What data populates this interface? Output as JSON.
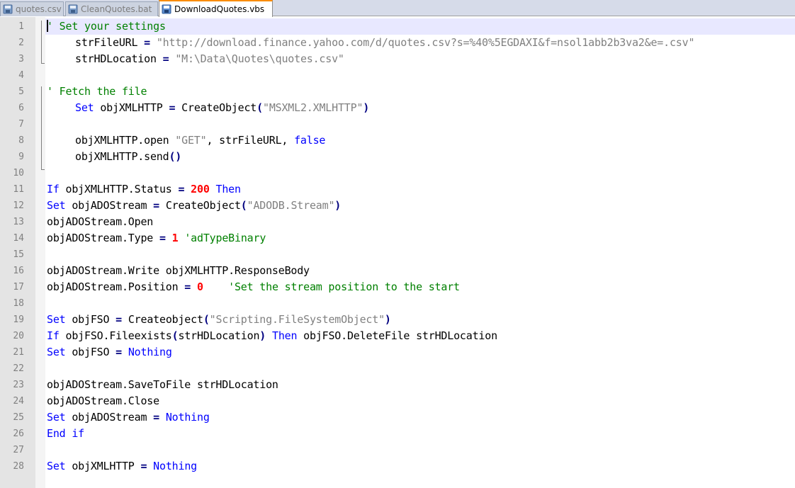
{
  "tabs": [
    {
      "label": "quotes.csv",
      "active": false,
      "icon": "file-saved-icon"
    },
    {
      "label": "CleanQuotes.bat",
      "active": false,
      "icon": "file-saved-icon"
    },
    {
      "label": "DownloadQuotes.vbs",
      "active": true,
      "icon": "file-saved-icon"
    }
  ],
  "colors": {
    "keyword": "#0000ff",
    "string": "#808080",
    "number": "#ff0000",
    "comment": "#008000",
    "current_line": "#e8e8ff",
    "active_tab_accent": "#fa8c00"
  },
  "lines": [
    {
      "n": "1",
      "tokens": [
        {
          "t": "' Set your settings",
          "c": "cmt"
        }
      ]
    },
    {
      "n": "2",
      "tokens": [
        {
          "t": "strFileURL ",
          "c": ""
        },
        {
          "t": "=",
          "c": "op"
        },
        {
          "t": " ",
          "c": ""
        },
        {
          "t": "\"http://download.finance.yahoo.com/d/quotes.csv?s=%40%5EGDAXI&f=nsol1abb2b3va2&e=.csv\"",
          "c": "str"
        }
      ]
    },
    {
      "n": "3",
      "tokens": [
        {
          "t": "strHDLocation ",
          "c": ""
        },
        {
          "t": "=",
          "c": "op"
        },
        {
          "t": " ",
          "c": ""
        },
        {
          "t": "\"M:\\Data\\Quotes\\quotes.csv\"",
          "c": "str"
        }
      ]
    },
    {
      "n": "4",
      "tokens": []
    },
    {
      "n": "5",
      "tokens": [
        {
          "t": "' Fetch the file",
          "c": "cmt"
        }
      ]
    },
    {
      "n": "6",
      "tokens": [
        {
          "t": "Set",
          "c": "kw"
        },
        {
          "t": " objXMLHTTP ",
          "c": ""
        },
        {
          "t": "=",
          "c": "op"
        },
        {
          "t": " CreateObject",
          "c": ""
        },
        {
          "t": "(",
          "c": "op"
        },
        {
          "t": "\"MSXML2.XMLHTTP\"",
          "c": "str"
        },
        {
          "t": ")",
          "c": "op"
        }
      ]
    },
    {
      "n": "7",
      "tokens": []
    },
    {
      "n": "8",
      "tokens": [
        {
          "t": "objXMLHTTP.open ",
          "c": ""
        },
        {
          "t": "\"GET\"",
          "c": "str"
        },
        {
          "t": ", strFileURL, ",
          "c": ""
        },
        {
          "t": "false",
          "c": "kw"
        }
      ]
    },
    {
      "n": "9",
      "tokens": [
        {
          "t": "objXMLHTTP.send",
          "c": ""
        },
        {
          "t": "()",
          "c": "op"
        }
      ]
    },
    {
      "n": "10",
      "tokens": []
    },
    {
      "n": "11",
      "tokens": [
        {
          "t": "If",
          "c": "kw"
        },
        {
          "t": " objXMLHTTP.Status ",
          "c": ""
        },
        {
          "t": "=",
          "c": "op"
        },
        {
          "t": " ",
          "c": ""
        },
        {
          "t": "200",
          "c": "num"
        },
        {
          "t": " ",
          "c": ""
        },
        {
          "t": "Then",
          "c": "kw"
        }
      ]
    },
    {
      "n": "12",
      "tokens": [
        {
          "t": "Set",
          "c": "kw"
        },
        {
          "t": " objADOStream ",
          "c": ""
        },
        {
          "t": "=",
          "c": "op"
        },
        {
          "t": " CreateObject",
          "c": ""
        },
        {
          "t": "(",
          "c": "op"
        },
        {
          "t": "\"ADODB.Stream\"",
          "c": "str"
        },
        {
          "t": ")",
          "c": "op"
        }
      ]
    },
    {
      "n": "13",
      "tokens": [
        {
          "t": "objADOStream.Open",
          "c": ""
        }
      ]
    },
    {
      "n": "14",
      "tokens": [
        {
          "t": "objADOStream.Type ",
          "c": ""
        },
        {
          "t": "=",
          "c": "op"
        },
        {
          "t": " ",
          "c": ""
        },
        {
          "t": "1",
          "c": "num"
        },
        {
          "t": " ",
          "c": ""
        },
        {
          "t": "'adTypeBinary",
          "c": "cmt"
        }
      ]
    },
    {
      "n": "15",
      "tokens": []
    },
    {
      "n": "16",
      "tokens": [
        {
          "t": "objADOStream.Write objXMLHTTP.ResponseBody",
          "c": ""
        }
      ]
    },
    {
      "n": "17",
      "tokens": [
        {
          "t": "objADOStream.Position ",
          "c": ""
        },
        {
          "t": "=",
          "c": "op"
        },
        {
          "t": " ",
          "c": ""
        },
        {
          "t": "0",
          "c": "num"
        },
        {
          "t": "    ",
          "c": ""
        },
        {
          "t": "'Set the stream position to the start",
          "c": "cmt"
        }
      ]
    },
    {
      "n": "18",
      "tokens": []
    },
    {
      "n": "19",
      "tokens": [
        {
          "t": "Set",
          "c": "kw"
        },
        {
          "t": " objFSO ",
          "c": ""
        },
        {
          "t": "=",
          "c": "op"
        },
        {
          "t": " Createobject",
          "c": ""
        },
        {
          "t": "(",
          "c": "op"
        },
        {
          "t": "\"Scripting.FileSystemObject\"",
          "c": "str"
        },
        {
          "t": ")",
          "c": "op"
        }
      ]
    },
    {
      "n": "20",
      "tokens": [
        {
          "t": "If",
          "c": "kw"
        },
        {
          "t": " objFSO.Fileexists",
          "c": ""
        },
        {
          "t": "(",
          "c": "op"
        },
        {
          "t": "strHDLocation",
          "c": ""
        },
        {
          "t": ")",
          "c": "op"
        },
        {
          "t": " ",
          "c": ""
        },
        {
          "t": "Then",
          "c": "kw"
        },
        {
          "t": " objFSO.DeleteFile strHDLocation",
          "c": ""
        }
      ]
    },
    {
      "n": "21",
      "tokens": [
        {
          "t": "Set",
          "c": "kw"
        },
        {
          "t": " objFSO ",
          "c": ""
        },
        {
          "t": "=",
          "c": "op"
        },
        {
          "t": " ",
          "c": ""
        },
        {
          "t": "Nothing",
          "c": "kw"
        }
      ]
    },
    {
      "n": "22",
      "tokens": []
    },
    {
      "n": "23",
      "tokens": [
        {
          "t": "objADOStream.SaveToFile strHDLocation",
          "c": ""
        }
      ]
    },
    {
      "n": "24",
      "tokens": [
        {
          "t": "objADOStream.Close",
          "c": ""
        }
      ]
    },
    {
      "n": "25",
      "tokens": [
        {
          "t": "Set",
          "c": "kw"
        },
        {
          "t": " objADOStream ",
          "c": ""
        },
        {
          "t": "=",
          "c": "op"
        },
        {
          "t": " ",
          "c": ""
        },
        {
          "t": "Nothing",
          "c": "kw"
        }
      ]
    },
    {
      "n": "26",
      "tokens": [
        {
          "t": "End",
          "c": "kw"
        },
        {
          "t": " ",
          "c": ""
        },
        {
          "t": "if",
          "c": "kw"
        }
      ]
    },
    {
      "n": "27",
      "tokens": []
    },
    {
      "n": "28",
      "tokens": [
        {
          "t": "Set",
          "c": "kw"
        },
        {
          "t": " objXMLHTTP ",
          "c": ""
        },
        {
          "t": "=",
          "c": "op"
        },
        {
          "t": " ",
          "c": ""
        },
        {
          "t": "Nothing",
          "c": "kw"
        }
      ]
    }
  ]
}
